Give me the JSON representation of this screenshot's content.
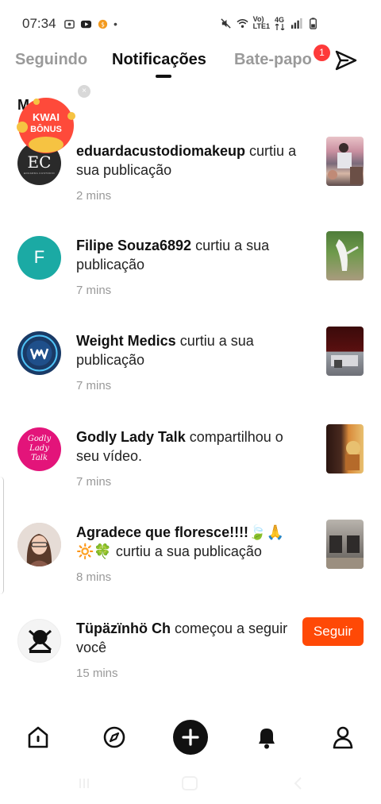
{
  "status_bar": {
    "time": "07:34",
    "dot": "•",
    "net_label_top": "Vo)",
    "net_label_bottom": "LTE1",
    "net_4g": "4G"
  },
  "tabs": [
    {
      "label": "Seguindo",
      "active": false
    },
    {
      "label": "Notificações",
      "active": true
    },
    {
      "label": "Bate-papo",
      "active": false,
      "badge": "1"
    }
  ],
  "section_header_partial": "M",
  "kwai_bonus": {
    "line1": "KWAI",
    "line2": "BÔNUS",
    "close": "×"
  },
  "notifications": [
    {
      "username": "eduardacustodiomakeup",
      "action": " curtiu a sua publicação",
      "time": "2 mins",
      "avatar_icon": "ec-logo-avatar",
      "avatar_initials": "EC",
      "avatar_subtitle": "EDUARDA CUSTODIO",
      "trailing": "thumbnail"
    },
    {
      "username": "Filipe Souza6892",
      "action": " curtiu a sua publicação",
      "time": "7 mins",
      "avatar_icon": "letter-avatar",
      "avatar_letter": "F",
      "trailing": "thumbnail"
    },
    {
      "username": "Weight Medics",
      "action": " curtiu a sua publicação",
      "time": "7 mins",
      "avatar_icon": "weight-medics-logo",
      "trailing": "thumbnail"
    },
    {
      "username": "Godly Lady Talk",
      "action": " compartilhou o seu vídeo.",
      "time": "7 mins",
      "avatar_icon": "godly-lady-logo",
      "avatar_text": "Godly Lady Talk",
      "trailing": "thumbnail"
    },
    {
      "username": "Agradece que floresce!!!!🍃🙏🔆🍀",
      "action": " curtiu a sua publicação",
      "time": "8 mins",
      "avatar_icon": "photo-avatar",
      "trailing": "thumbnail"
    },
    {
      "username": "Tüpäzïnhö Ch",
      "action": " começou a seguir você",
      "time": "15 mins",
      "avatar_icon": "emblem-avatar",
      "trailing": "follow",
      "follow_label": "Seguir"
    }
  ],
  "bottom_nav": [
    {
      "icon": "home-icon"
    },
    {
      "icon": "discover-compass-icon"
    },
    {
      "icon": "create-plus-icon"
    },
    {
      "icon": "notifications-bell-icon"
    },
    {
      "icon": "profile-icon"
    }
  ],
  "colors": {
    "accent_orange": "#ff4906",
    "badge_red": "#fe3a3a",
    "filipe_avatar": "#1baaa4",
    "godly_avatar": "#e3147a",
    "weight_medics_avatar": "#1a3a66"
  }
}
